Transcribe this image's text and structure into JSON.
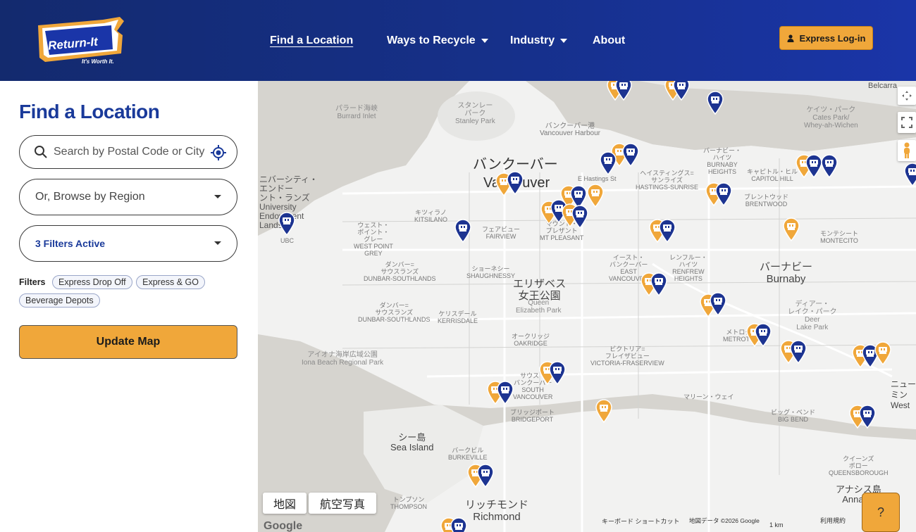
{
  "brand": {
    "logo_text": "Return-It",
    "tagline": "It's Worth It.",
    "accent": "#f0a73a",
    "primary": "#16308a"
  },
  "nav": {
    "items": [
      {
        "label": "Find a Location",
        "active": true,
        "dropdown": false
      },
      {
        "label": "Ways to Recycle",
        "active": false,
        "dropdown": true
      },
      {
        "label": "Industry",
        "active": false,
        "dropdown": true
      },
      {
        "label": "About",
        "active": false,
        "dropdown": false
      }
    ],
    "login_label": "Express Log-in",
    "login_icon": "user-icon"
  },
  "sidebar": {
    "title": "Find a Location",
    "search_placeholder": "Search by Postal Code or City",
    "search_value": "",
    "region_select": "Or, Browse by Region",
    "filters_select": "3 Filters Active",
    "filters_label": "Filters",
    "filter_chips": [
      "Express Drop Off",
      "Express & GO",
      "Beverage Depots"
    ],
    "update_label": "Update Map"
  },
  "map": {
    "labels": [
      {
        "t": "パラード海峡\nBurrard Inlet",
        "c": "park"
      },
      {
        "t": "スタンレー\nパーク\nStanley Park",
        "c": "park"
      },
      {
        "t": "バンクーバー港\nVancouver Harbour",
        "c": ""
      },
      {
        "t": "ケイツ・パーク\nCates Park/\nWhey-ah-Wichen",
        "c": "park"
      },
      {
        "t": "バンクーバー",
        "c": "big"
      },
      {
        "t": "Vancouver",
        "c": "big"
      },
      {
        "t": "ニバーシティ・\nエンドー\nント・ランズ\nUniversity\nEndowment\nLands",
        "c": ""
      },
      {
        "t": "UBC",
        "c": ""
      },
      {
        "t": "キツィラノ\nKITSILANO",
        "c": ""
      },
      {
        "t": "ウェスト・\nポイント・\nグレー\nWEST POINT\nGREY",
        "c": ""
      },
      {
        "t": "フェアビュー\nFAIRVIEW",
        "c": ""
      },
      {
        "t": "マウント・\nプレザント\nMT PLEASANT",
        "c": ""
      },
      {
        "t": "ヘイスティングス=\nサンライズ\nHASTINGS-SUNRISE",
        "c": ""
      },
      {
        "t": "バーナビー・\nハイツ\nBURNABY\nHEIGHTS",
        "c": ""
      },
      {
        "t": "キャピトル・ヒル\nCAPITOL HILL",
        "c": ""
      },
      {
        "t": "ブレントウッド\nBRENTWOOD",
        "c": ""
      },
      {
        "t": "モンテシート\nMONTECITO",
        "c": ""
      },
      {
        "t": "ダンバー=\nサウスランズ\nDUNBAR-SOUTHLANDS",
        "c": ""
      },
      {
        "t": "ショーネシー\nSHAUGHNESSY",
        "c": ""
      },
      {
        "t": "エリザベス\n女王公園",
        "c": "mid"
      },
      {
        "t": "Queen\nElizabeth Park",
        "c": "park"
      },
      {
        "t": "イースト・\nバンクーバー\nEAST\nVANCOUVER",
        "c": ""
      },
      {
        "t": "レンフルー・\nハイツ\nRENFREW\nHEIGHTS",
        "c": ""
      },
      {
        "t": "バーナビー\nBurnaby",
        "c": "mid"
      },
      {
        "t": "ディアー・\nレイク・パーク\nDeer\nLake Park",
        "c": "park"
      },
      {
        "t": "ダンバー=\nサウスランズ\nDUNBAR-SOUTHLANDS",
        "c": ""
      },
      {
        "t": "ケリスデール\nKERRISDALE",
        "c": ""
      },
      {
        "t": "オークリッジ\nOAKRIDGE",
        "c": ""
      },
      {
        "t": "メトロタ\nMETROTO",
        "c": ""
      },
      {
        "t": "ビクトリア=\nフレイザビュー\nVICTORIA-FRASERVIEW",
        "c": ""
      },
      {
        "t": "アイオナ海岸広域公園\nIona Beach Regional Park",
        "c": "park"
      },
      {
        "t": "サウス・\nバンクーバー\nSOUTH\nVANCOUVER",
        "c": ""
      },
      {
        "t": "ブリッジポート\nBRIDGEPORT",
        "c": ""
      },
      {
        "t": "マリーン・ウェイ",
        "c": ""
      },
      {
        "t": "ビッグ・ベンド\nBIG BEND",
        "c": ""
      },
      {
        "t": "シー島\nSea Island",
        "c": "mid"
      },
      {
        "t": "バークビル\nBURKEVILLE",
        "c": ""
      },
      {
        "t": "トンプソン\nTHOMPSON",
        "c": ""
      },
      {
        "t": "リッチモンド\nRichmond",
        "c": "mid"
      },
      {
        "t": "クイーンズ\nボロー\nQUEENSBOROUGH",
        "c": ""
      },
      {
        "t": "アナシス島\nAnnacis",
        "c": "mid"
      },
      {
        "t": "E Hastings St",
        "c": ""
      },
      {
        "t": "Belcarra",
        "c": ""
      },
      {
        "t": "ニュー\nミン\nWest",
        "c": ""
      }
    ],
    "type_map": "地図",
    "type_satellite": "航空写真",
    "google_label": "Google",
    "attribution_keys": "キーボード ショートカット",
    "attribution_data": "地図データ ©2026 Google",
    "scale_label": "1 km",
    "terms": "利用規約",
    "help_label": "?"
  }
}
